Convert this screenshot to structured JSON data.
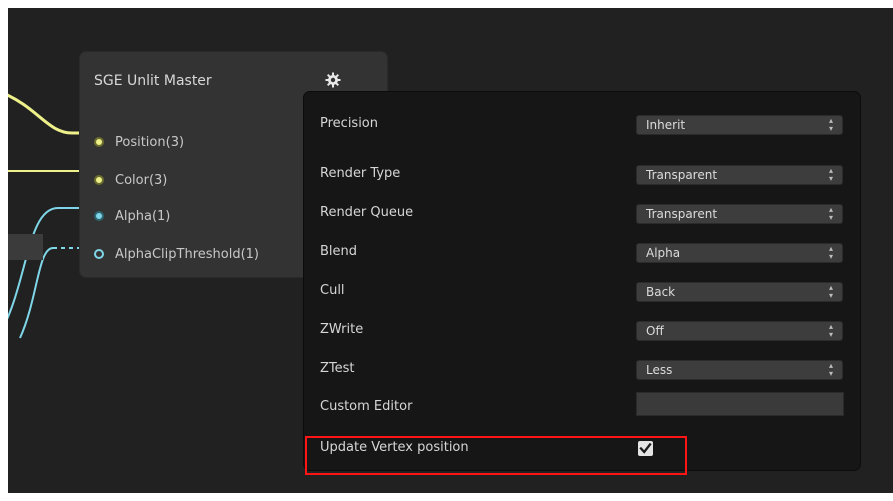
{
  "node": {
    "title": "SGE Unlit Master",
    "ports": [
      {
        "label": "Position(3)"
      },
      {
        "label": "Color(3)"
      },
      {
        "label": "Alpha(1)"
      },
      {
        "label": "AlphaClipThreshold(1)"
      }
    ]
  },
  "settings": {
    "precision": {
      "label": "Precision",
      "value": "Inherit"
    },
    "render_type": {
      "label": "Render Type",
      "value": "Transparent"
    },
    "render_queue": {
      "label": "Render Queue",
      "value": "Transparent"
    },
    "blend": {
      "label": "Blend",
      "value": "Alpha"
    },
    "cull": {
      "label": "Cull",
      "value": "Back"
    },
    "zwrite": {
      "label": "ZWrite",
      "value": "Off"
    },
    "ztest": {
      "label": "ZTest",
      "value": "Less"
    },
    "custom_editor": {
      "label": "Custom Editor",
      "value": ""
    },
    "update_vertex_position": {
      "label": "Update Vertex position",
      "checked": true
    }
  },
  "colors": {
    "wire_yellow": "#eef08a",
    "wire_cyan": "#7fd6e8",
    "highlight": "#ff1515"
  },
  "icons": [
    "gear-icon",
    "dropdown-arrows-icon",
    "checkmark-icon"
  ]
}
